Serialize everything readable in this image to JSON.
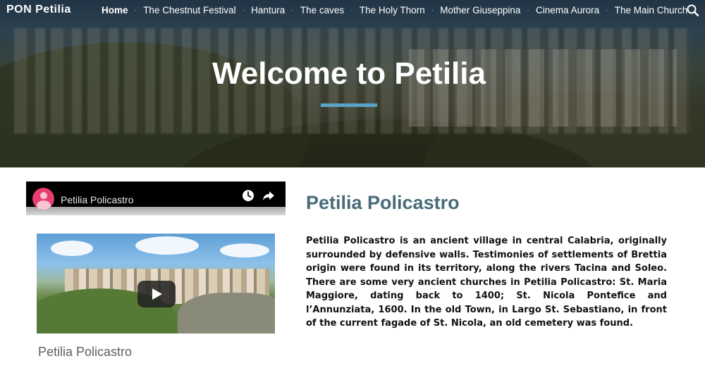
{
  "site": {
    "logo": "PON Petilia"
  },
  "nav": {
    "items": [
      {
        "label": "Home",
        "active": true
      },
      {
        "label": "The Chestnut Festival"
      },
      {
        "label": "Hantura"
      },
      {
        "label": "The caves"
      },
      {
        "label": "The Holy Thorn"
      },
      {
        "label": "Mother Giuseppina"
      },
      {
        "label": "Cinema Aurora"
      },
      {
        "label": "The Main Church"
      }
    ],
    "separator": "·",
    "search_icon": "search-icon"
  },
  "hero": {
    "title": "Welcome to Petilia",
    "accent_color": "#5aa3c6"
  },
  "video": {
    "channel_title": "Petilia Policastro",
    "caption": "Petilia Policastro",
    "icons": [
      "avatar",
      "watch-later-icon",
      "share-icon",
      "play-icon"
    ]
  },
  "content": {
    "title": "Petilia Policastro",
    "title_color": "#486b7a",
    "body": "Petilia Policastro is an ancient village in central Calabria, originally surrounded by defensive walls. Testimonies of settlements of Brettia origin were found in its territory, along the rivers Tacina and Soleo. There are some very ancient churches in Petilia Policastro: St. Maria Maggiore, dating back to 1400; St. Nicola Pontefice and l’Annunziata, 1600. In the old Town, in Largo St. Sebastiano, in front of the current fagade of St. Nicola, an old cemetery was found."
  }
}
